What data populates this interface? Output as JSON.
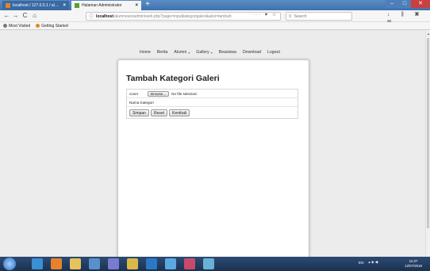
{
  "browser": {
    "tabs": [
      {
        "label": "localhost / 127.0.0.1 / alumni",
        "active": false
      },
      {
        "label": "Halaman Administrator",
        "active": true
      }
    ],
    "new_tab_symbol": "+",
    "nav": {
      "back": "←",
      "forward": "→",
      "reload": "C",
      "home": "⌂"
    },
    "url": {
      "host": "localhost",
      "path": "/alumnews/admin/web.php?page=inputkategorigaleri&aksi=tambah"
    },
    "url_actions": "··· ♥ ☆",
    "search_placeholder": "Search",
    "toolbar_icons": "↓ ⫼ ▣ ☰",
    "bookmarks": [
      {
        "label": "Most Visited",
        "icon": "gear-icon"
      },
      {
        "label": "Getting Started",
        "icon": "firefox-icon"
      }
    ],
    "window_controls": {
      "minimize": "–",
      "maximize": "□",
      "close": "✕"
    }
  },
  "site": {
    "nav": [
      {
        "label": "Home",
        "dropdown": false
      },
      {
        "label": "Berita",
        "dropdown": false
      },
      {
        "label": "Alumni",
        "dropdown": true
      },
      {
        "label": "Gallery",
        "dropdown": true
      },
      {
        "label": "Beasiswa",
        "dropdown": false
      },
      {
        "label": "Download",
        "dropdown": false
      },
      {
        "label": "Logout",
        "dropdown": false
      }
    ],
    "dropdown_caret": "▾"
  },
  "form": {
    "title": "Tambah Kategori Galeri",
    "cover_label": "cover",
    "browse_label": "Browse...",
    "file_status": "No file selected.",
    "name_label": "Nama Kategori",
    "buttons": {
      "save": "Simpan",
      "reset": "Reset",
      "back": "Kembali"
    }
  },
  "taskbar": {
    "tray_lang": "EN",
    "tray_icons": "▴ ◈ ◀",
    "time": "11:37",
    "date": "12/07/2018"
  },
  "colors": {
    "titlebar": "#3f72ad",
    "taskbar": "#1b3152",
    "caret": "#3a8a3a"
  }
}
